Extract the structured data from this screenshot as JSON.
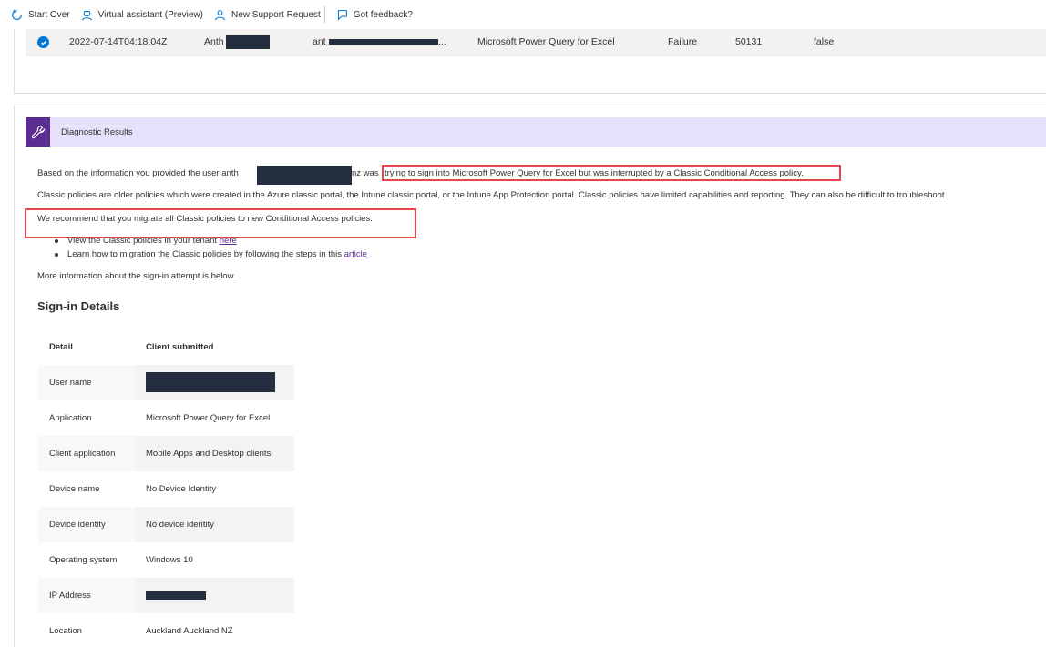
{
  "toolbar": {
    "start_over": "Start Over",
    "virtual_assistant": "Virtual assistant (Preview)",
    "new_support_request": "New Support Request",
    "got_feedback": "Got feedback?"
  },
  "selected_row": {
    "timestamp": "2022-07-14T04:18:04Z",
    "user_prefix": "Anth",
    "email_prefix": "ant",
    "email_ellipsis": "...",
    "application": "Microsoft Power Query for Excel",
    "status": "Failure",
    "error_code": "50131",
    "flag": "false"
  },
  "diagnostic": {
    "title": "Diagnostic Results",
    "line1_before": "Based on the information you provided the user anth",
    "line1_after": "nz was",
    "line1_highlight": "trying to sign into Microsoft Power Query for Excel but was interrupted by a Classic Conditional Access policy.",
    "line2": "Classic policies are older policies which were created in the Azure classic portal, the Intune classic portal, or the Intune App Protection portal. Classic policies have limited capabilities and reporting. They can also be difficult to troubleshoot.",
    "line3": "We recommend that you migrate all Classic policies to new Conditional Access policies.",
    "bullet1_text": "View the Classic policies in your tenant ",
    "bullet1_link": "here",
    "bullet2_text": "Learn how to migration the Classic policies by following the steps in this ",
    "bullet2_link": "article",
    "more_info": "More information about the sign-in attempt is below."
  },
  "signin": {
    "heading": "Sign-in Details",
    "col_detail": "Detail",
    "col_client": "Client submitted",
    "rows": [
      {
        "label": "User name",
        "value": ""
      },
      {
        "label": "Application",
        "value": "Microsoft Power Query for Excel"
      },
      {
        "label": "Client application",
        "value": "Mobile Apps and Desktop clients"
      },
      {
        "label": "Device name",
        "value": "No Device Identity"
      },
      {
        "label": "Device identity",
        "value": "No device identity"
      },
      {
        "label": "Operating system",
        "value": "Windows 10"
      },
      {
        "label": "IP Address",
        "value": ""
      },
      {
        "label": "Location",
        "value": "Auckland Auckland NZ"
      }
    ]
  },
  "colors": {
    "accent": "#0078d4",
    "header_purple": "#5c2d91",
    "header_bg": "#e6e0fa",
    "highlight_red": "#e8454b",
    "redaction": "#232f3e"
  }
}
